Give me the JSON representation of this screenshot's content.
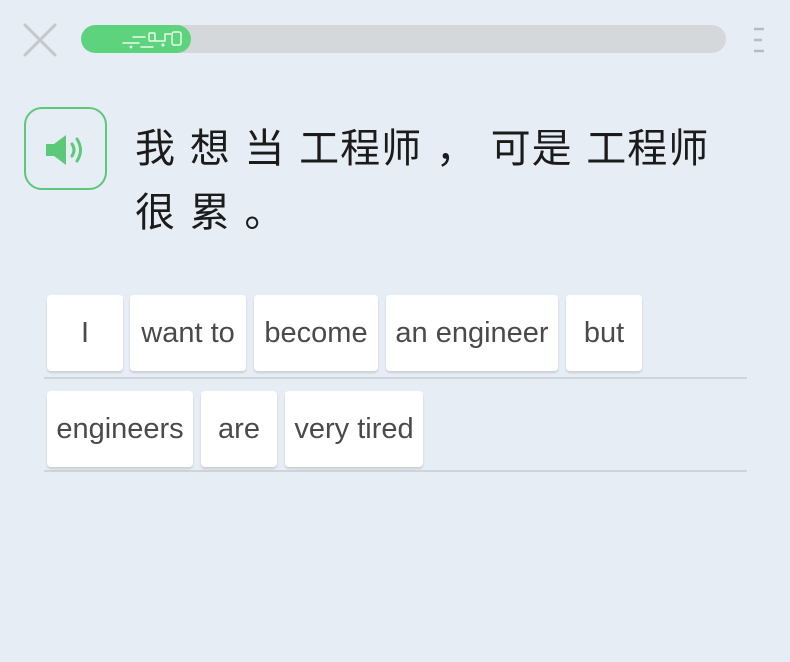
{
  "header": {
    "close_icon": "close-icon",
    "menu_icon": "menu-icon",
    "progress": 0.17,
    "progress_color": "#5cd37c",
    "track_color": "#d5d8da"
  },
  "prompt": {
    "audio_icon": "speaker-icon",
    "accent_color": "#5cc879",
    "sentence": "我 想 当 工程师 ， 可是 工程师 很 累 。"
  },
  "word_bank": {
    "rows": [
      [
        "I",
        "want to",
        "become",
        "an engineer",
        "but"
      ],
      [
        "engineers",
        "are",
        "very tired"
      ]
    ]
  }
}
